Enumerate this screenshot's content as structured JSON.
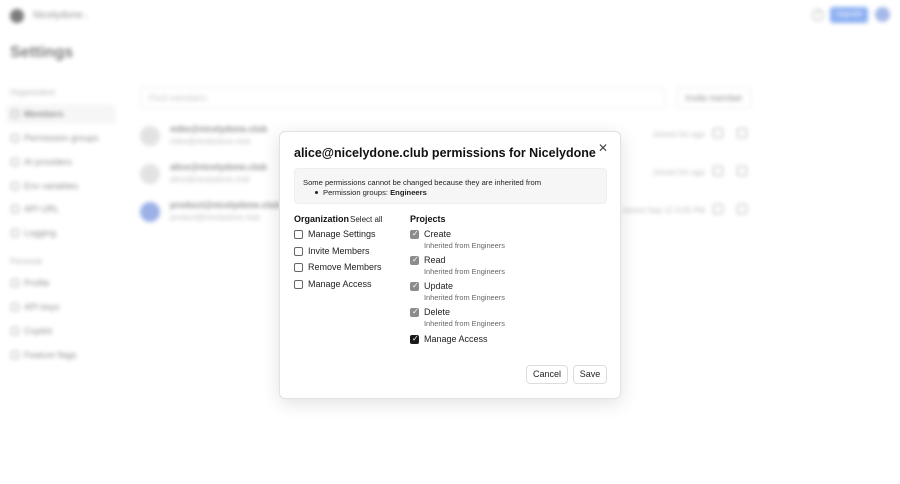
{
  "topbar": {
    "org_name": "Nicelydone",
    "help_glyph": "?",
    "upgrade_label": "Upgrade"
  },
  "page": {
    "title": "Settings"
  },
  "sidebar": {
    "org_section": "Organization",
    "org_items": [
      {
        "label": "Members",
        "icon": "members-icon"
      },
      {
        "label": "Permission groups",
        "icon": "lock-icon"
      },
      {
        "label": "AI providers",
        "icon": "sparkle-icon"
      },
      {
        "label": "Env variables",
        "icon": "code-icon"
      },
      {
        "label": "API URL",
        "icon": "link-icon"
      },
      {
        "label": "Logging",
        "icon": "document-icon"
      }
    ],
    "personal_section": "Personal",
    "personal_items": [
      {
        "label": "Profile",
        "icon": "user-icon"
      },
      {
        "label": "API keys",
        "icon": "key-icon"
      },
      {
        "label": "Copilot",
        "icon": "copilot-icon"
      },
      {
        "label": "Feature flags",
        "icon": "flag-icon"
      }
    ]
  },
  "members": {
    "search_placeholder": "Find members",
    "invite_label": "Invite member",
    "rows": [
      {
        "name": "mike@nicelydone.club",
        "email": "mike@nicelydone.club",
        "joined": "Joined 5m ago"
      },
      {
        "name": "alice@nicelydone.club",
        "email": "alice@nicelydone.club",
        "joined": "Joined 5m ago"
      },
      {
        "name": "product@nicelydone.club",
        "email": "product@nicelydone.club",
        "joined": "Joined Sep 12 4:05 PM"
      }
    ]
  },
  "modal": {
    "title": "alice@nicelydone.club permissions for Nicelydone",
    "notice_text": "Some permissions cannot be changed because they are inherited from",
    "notice_bullet_prefix": "Permission groups: ",
    "notice_bullet_group": "Engineers",
    "organization_heading": "Organization",
    "select_all_label": "Select all",
    "projects_heading": "Projects",
    "org_permissions": [
      {
        "label": "Manage Settings",
        "checked": false
      },
      {
        "label": "Invite Members",
        "checked": false
      },
      {
        "label": "Remove Members",
        "checked": false
      },
      {
        "label": "Manage Access",
        "checked": false
      }
    ],
    "project_permissions": [
      {
        "label": "Create",
        "sub": "Inherited from Engineers",
        "checked": true,
        "inherited": true
      },
      {
        "label": "Read",
        "sub": "Inherited from Engineers",
        "checked": true,
        "inherited": true
      },
      {
        "label": "Update",
        "sub": "Inherited from Engineers",
        "checked": true,
        "inherited": true
      },
      {
        "label": "Delete",
        "sub": "Inherited from Engineers",
        "checked": true,
        "inherited": true
      },
      {
        "label": "Manage Access",
        "sub": "",
        "checked": true,
        "inherited": false
      }
    ],
    "cancel_label": "Cancel",
    "save_label": "Save",
    "close_glyph": "✕",
    "check_glyph": "✓"
  },
  "colors": {
    "accent": "#2f6fe8",
    "inherited_check": "#8c8c8c",
    "active_check": "#1a1a1a"
  }
}
